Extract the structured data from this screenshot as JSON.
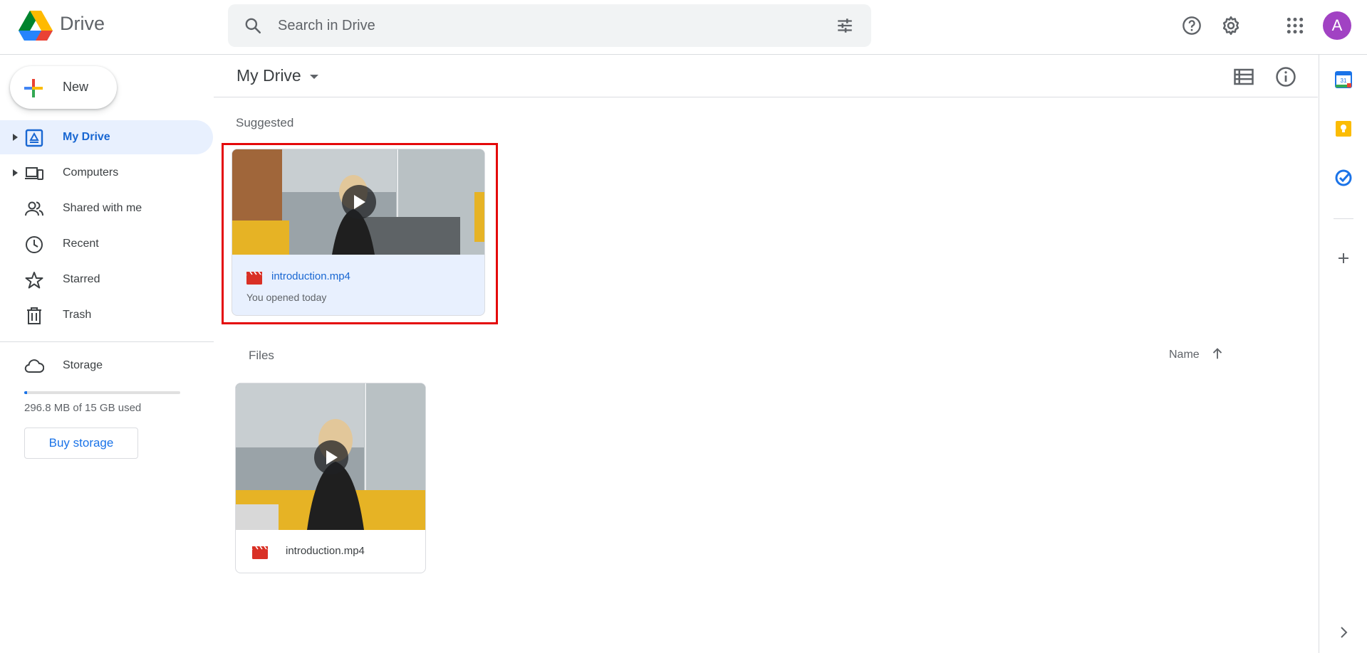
{
  "app": {
    "brand": "Drive"
  },
  "search": {
    "placeholder": "Search in Drive"
  },
  "header": {
    "avatar_letter": "A",
    "icons": [
      "help-icon",
      "settings-icon",
      "apps-grid-icon"
    ]
  },
  "sidebar": {
    "new_label": "New",
    "items": [
      {
        "label": "My Drive",
        "icon": "my-drive-icon",
        "active": true,
        "expandable": true
      },
      {
        "label": "Computers",
        "icon": "computers-icon",
        "active": false,
        "expandable": true
      },
      {
        "label": "Shared with me",
        "icon": "shared-icon",
        "active": false,
        "expandable": false
      },
      {
        "label": "Recent",
        "icon": "clock-icon",
        "active": false,
        "expandable": false
      },
      {
        "label": "Starred",
        "icon": "star-icon",
        "active": false,
        "expandable": false
      },
      {
        "label": "Trash",
        "icon": "trash-icon",
        "active": false,
        "expandable": false
      }
    ],
    "storage": {
      "label": "Storage",
      "used_text": "296.8 MB of 15 GB used",
      "used_fraction": 0.019,
      "buy_label": "Buy storage"
    }
  },
  "main": {
    "title": "My Drive",
    "suggested": {
      "label": "Suggested",
      "card": {
        "name": "introduction.mp4",
        "subtitle": "You opened today",
        "type_icon": "video-file-icon"
      }
    },
    "files": {
      "label": "Files",
      "sort_label": "Name",
      "sort_direction": "ascending",
      "items": [
        {
          "name": "introduction.mp4",
          "type_icon": "video-file-icon"
        }
      ]
    }
  },
  "right_rail": {
    "icons": [
      "calendar-icon",
      "keep-icon",
      "tasks-icon",
      "add-icon",
      "expand-icon"
    ],
    "calendar_day": "31"
  },
  "colors": {
    "accent": "#1a73e8",
    "active_bg": "#e8f0fe",
    "highlight": "#e4080a",
    "avatar": "#a142c3",
    "video_icon": "#d93025"
  }
}
